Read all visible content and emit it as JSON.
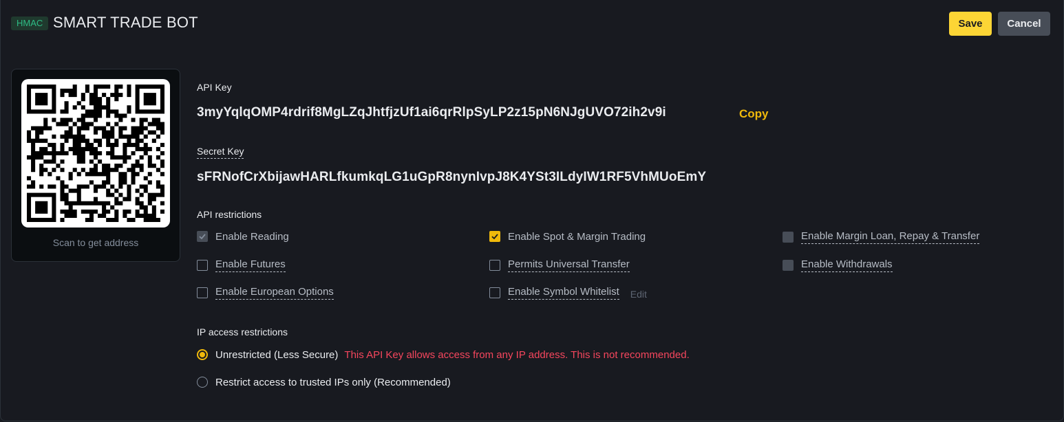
{
  "header": {
    "badge": "HMAC",
    "title": "SMART TRADE BOT",
    "save_label": "Save",
    "cancel_label": "Cancel"
  },
  "qr": {
    "caption": "Scan to get address"
  },
  "api_key": {
    "label": "API Key",
    "value": "3myYqlqOMP4rdrif8MgLZqJhtfjzUf1ai6qrRlpSyLP2z15pN6NJgUVO72ih2v9i",
    "copy_label": "Copy"
  },
  "secret_key": {
    "label": "Secret Key",
    "value": "sFRNofCrXbijawHARLfkumkqLG1uGpR8nynIvpJ8K4YSt3ILdyIW1RF5VhMUoEmY"
  },
  "restrictions": {
    "heading": "API restrictions",
    "options": [
      {
        "label": "Enable Reading",
        "state": "checked-disabled"
      },
      {
        "label": "Enable Spot & Margin Trading",
        "state": "checked"
      },
      {
        "label": "Enable Margin Loan, Repay & Transfer",
        "state": "disabled"
      },
      {
        "label": "Enable Futures",
        "state": "unchecked"
      },
      {
        "label": "Permits Universal Transfer",
        "state": "unchecked"
      },
      {
        "label": "Enable Withdrawals",
        "state": "disabled"
      },
      {
        "label": "Enable European Options",
        "state": "unchecked"
      },
      {
        "label": "Enable Symbol Whitelist",
        "state": "unchecked"
      }
    ],
    "edit_label": "Edit"
  },
  "ip": {
    "heading": "IP access restrictions",
    "unrestricted_label": "Unrestricted (Less Secure)",
    "unrestricted_warning": "This API Key allows access from any IP address. This is not recommended.",
    "restrict_label": "Restrict access to trusted IPs only (Recommended)",
    "selected": "unrestricted"
  },
  "colors": {
    "accent": "#f0b90b",
    "save_button": "#fcd535",
    "warning": "#f6465d",
    "badge": "#2ebd85"
  }
}
